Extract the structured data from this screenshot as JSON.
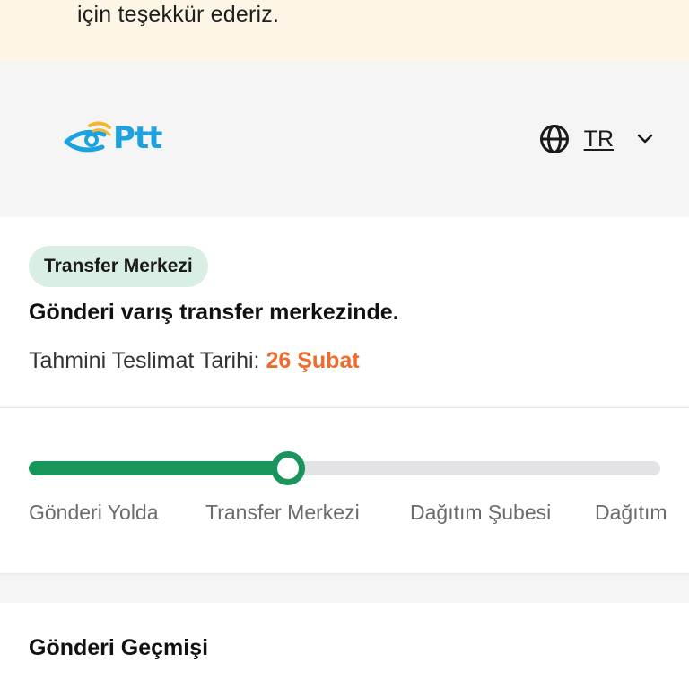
{
  "banner": {
    "text": "için teşekkür ederiz."
  },
  "header": {
    "logo_text": "Ptt",
    "language": {
      "code": "TR",
      "icon": "globe-icon",
      "dropdown_icon": "chevron-down-icon"
    }
  },
  "status": {
    "badge": "Transfer Merkezi",
    "title": "Gönderi varış transfer merkezinde.",
    "eta_label": "Tahmini Teslimat Tarihi:",
    "eta_date": "26 Şubat"
  },
  "progress": {
    "value": 0.41,
    "steps": [
      {
        "label": "Gönderi Yolda"
      },
      {
        "label": "Transfer Merkezi"
      },
      {
        "label": "Dağıtım Şubesi"
      },
      {
        "label": "Dağıtım"
      }
    ]
  },
  "history": {
    "title": "Gönderi Geçmişi"
  },
  "colors": {
    "accent_green": "#17955a",
    "badge_bg": "#d9efe3",
    "eta_orange": "#ee6b2e",
    "logo_blue": "#1aa3e0",
    "logo_orange": "#f5b731"
  }
}
